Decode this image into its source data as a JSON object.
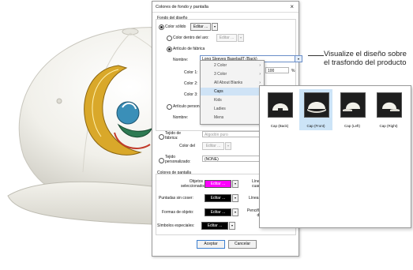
{
  "dialog": {
    "title": "Colores de fondo y pantalla",
    "close": "×",
    "section_design_bg": "Fondo del diseño",
    "opt_solid": "Color sólido",
    "btn_edit_solid": "Editar ...",
    "opt_inside_hoop": "Color dentro del aro:",
    "btn_edit_hoop": "Editar ...",
    "opt_fabric": "Artículo de fábrica",
    "lbl_name": "Nombre:",
    "fabric_name": "Long Sleeves BaseballT (Back)",
    "lbl_color1": "Color 1:",
    "lbl_color2": "Color 2:",
    "lbl_color3": "Color 3:",
    "zoom_value": "100",
    "zoom_unit": "%",
    "opt_personal": "Artículo person",
    "lbl_name2": "Nombre:",
    "opt_fabric_weave": "Tejido de fábrica:",
    "fabric_weave_placeholder": "Algodón puro",
    "lbl_color_of": "Color del",
    "btn_edit_weave": "Editar ...",
    "opt_custom_weave": "Tejido personalizado:",
    "custom_weave_value": "(NONE)",
    "section_screen": "Colores de pantalla",
    "lbl_selected_objects": "Objetos seleccionados:",
    "btn_edit_selected": "Editar ...",
    "lbl_lines": "Líne cuadr",
    "lbl_unsewn": "Puntadas sin coser:",
    "btn_edit_unsewn": "Editar ...",
    "lbl_line2": "Línea",
    "lbl_shapes": "Formas de objeto:",
    "btn_edit_shapes": "Editar ...",
    "lbl_pen": "Penciña de",
    "lbl_special": "Símbolos especiales:",
    "btn_edit_special": "Editar ...",
    "btn_ok": "Aceptar",
    "btn_cancel": "Cancelar"
  },
  "menu": {
    "items": [
      "2 Color",
      "3 Color",
      "All About Blanks",
      "Caps",
      "Kids",
      "Ladies",
      "Mens"
    ],
    "highlighted": "Caps"
  },
  "panel": {
    "tiles": [
      "Cap (Back)",
      "Cap (Front)",
      "Cap (Left)",
      "Cap (Right)"
    ],
    "selected": "Cap (Front)"
  },
  "annotation": "Visualize el diseño sobre el trasfondo del producto",
  "colors": {
    "selected_objects": "#ff00ff",
    "unsewn": "#000000",
    "shapes": "#000000",
    "special": "#000000",
    "cap": "#f4f3ee",
    "highlight": "#cce4f7"
  }
}
